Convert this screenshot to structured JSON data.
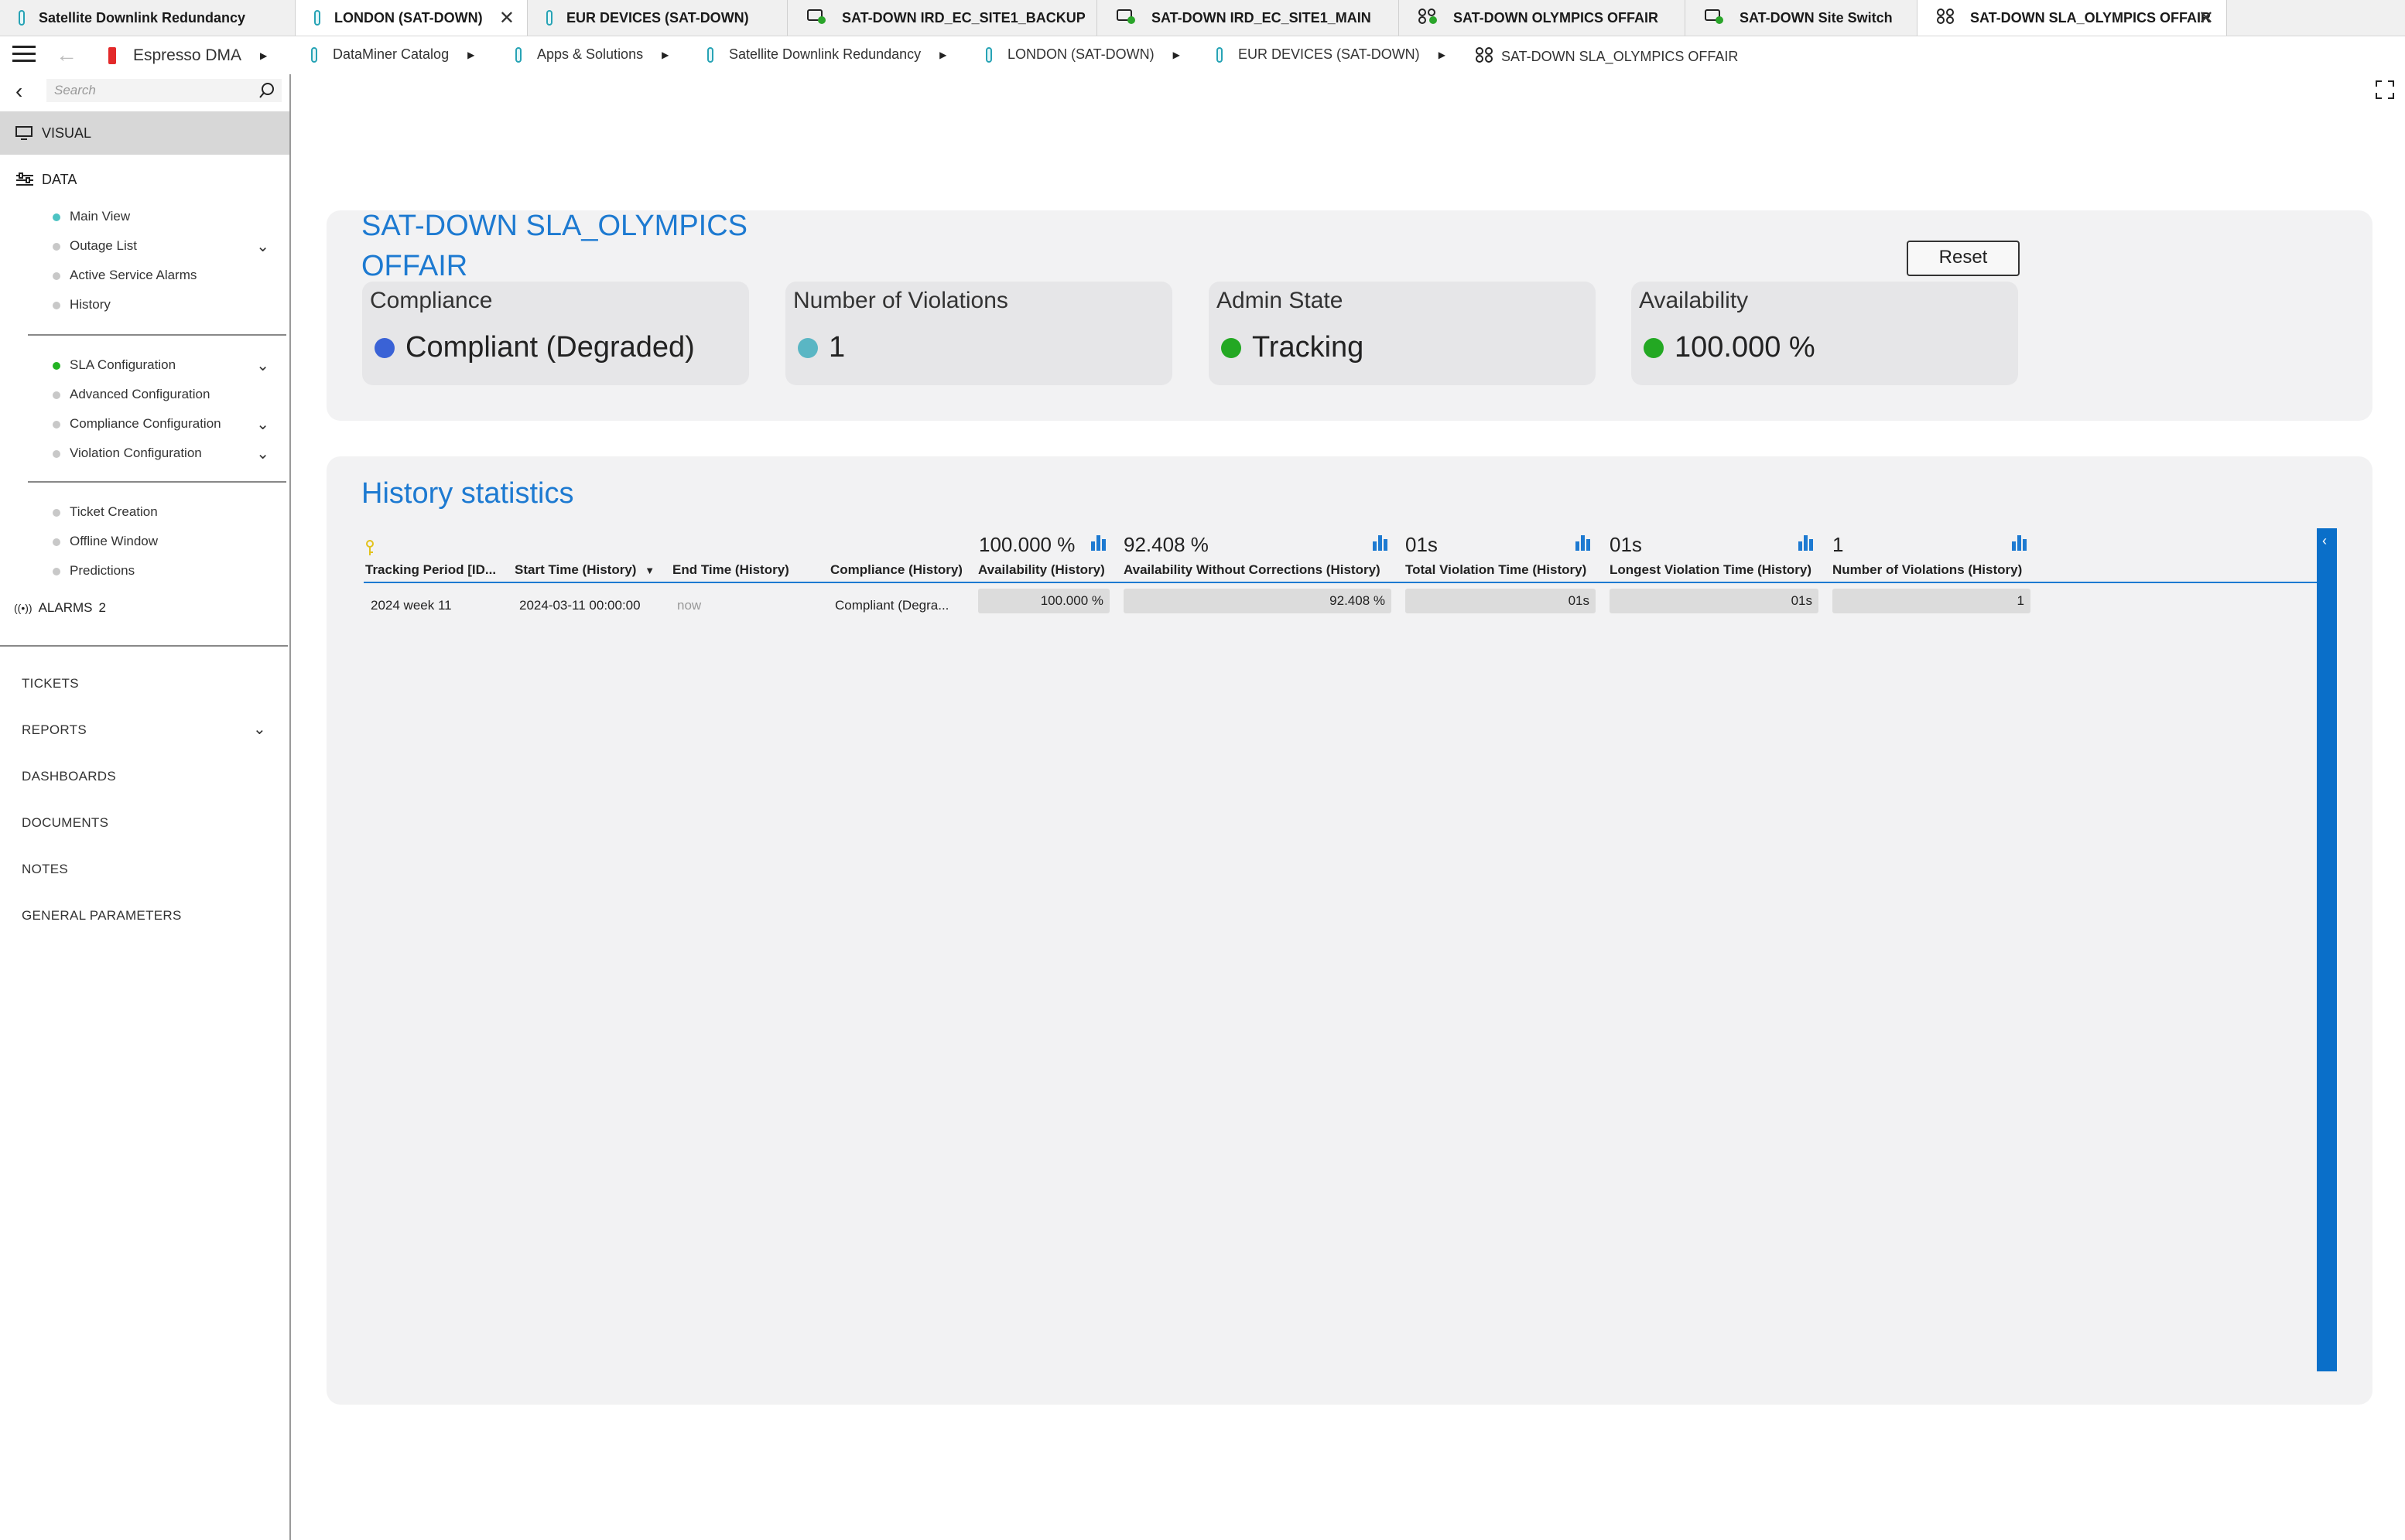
{
  "tabs": [
    {
      "label": "Satellite Downlink Redundancy"
    },
    {
      "label": "LONDON (SAT-DOWN)"
    },
    {
      "label": "EUR DEVICES (SAT-DOWN)"
    },
    {
      "label": "SAT-DOWN IRD_EC_SITE1_BACKUP"
    },
    {
      "label": "SAT-DOWN IRD_EC_SITE1_MAIN"
    },
    {
      "label": "SAT-DOWN OLYMPICS OFFAIR"
    },
    {
      "label": "SAT-DOWN Site Switch"
    },
    {
      "label": "SAT-DOWN SLA_OLYMPICS OFFAIR"
    }
  ],
  "breadcrumb": {
    "root": "Espresso DMA",
    "items": [
      "DataMiner Catalog",
      "Apps & Solutions",
      "Satellite Downlink Redundancy",
      "LONDON (SAT-DOWN)",
      "EUR DEVICES (SAT-DOWN)",
      "SAT-DOWN SLA_OLYMPICS OFFAIR"
    ]
  },
  "sidebar": {
    "search_placeholder": "Search",
    "visual": "VISUAL",
    "data": "DATA",
    "group1": [
      "Main View",
      "Outage List",
      "Active Service Alarms",
      "History"
    ],
    "group2": [
      "SLA Configuration",
      "Advanced Configuration",
      "Compliance Configuration",
      "Violation Configuration"
    ],
    "group3": [
      "Ticket Creation",
      "Offline Window",
      "Predictions"
    ],
    "alarms": "ALARMS",
    "alarms_count": "2",
    "bottom": [
      "TICKETS",
      "REPORTS",
      "DASHBOARDS",
      "DOCUMENTS",
      "NOTES",
      "GENERAL PARAMETERS"
    ]
  },
  "summary": {
    "title_line1": "SAT-DOWN SLA_OLYMPICS",
    "title_line2": "OFFAIR",
    "reset": "Reset",
    "cards": [
      {
        "label": "Compliance",
        "value": "Compliant (Degraded)",
        "color": "#3a62d6"
      },
      {
        "label": "Number of Violations",
        "value": "1",
        "color": "#5ab6c4"
      },
      {
        "label": "Admin State",
        "value": "Tracking",
        "color": "#23a823"
      },
      {
        "label": "Availability",
        "value": "100.000 %",
        "color": "#23a823"
      }
    ]
  },
  "history": {
    "title": "History statistics",
    "columns": [
      "Tracking Period [ID...",
      "Start Time (History)",
      "End Time (History)",
      "Compliance (History)",
      "Availability (History)",
      "Availability Without Corrections (History)",
      "Total Violation Time (History)",
      "Longest Violation Time (History)",
      "Number of Violations (History)"
    ],
    "aggregates": [
      "100.000 %",
      "92.408 %",
      "01s",
      "01s",
      "1"
    ],
    "row": {
      "period": "2024 week 11",
      "start": "2024-03-11 00:00:00",
      "end": "now",
      "compliance": "Compliant (Degra...",
      "availability": "100.000 %",
      "availability_wo": "92.408 %",
      "total_violation": "01s",
      "longest_violation": "01s",
      "violations": "1"
    },
    "accent": "#0a6fc9"
  }
}
